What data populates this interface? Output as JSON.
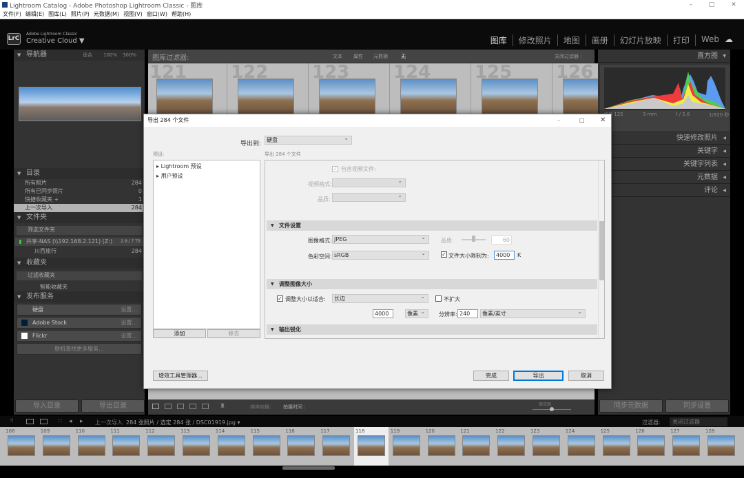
{
  "window": {
    "title": "Lightroom Catalog - Adobe Photoshop Lightroom Classic - 图库",
    "controls": [
      "–",
      "□",
      "✕"
    ]
  },
  "menu": [
    "文件(F)",
    "编辑(E)",
    "图库(L)",
    "照片(P)",
    "元数据(M)",
    "视图(V)",
    "窗口(W)",
    "帮助(H)"
  ],
  "identity": {
    "logo": "LrC",
    "line1": "Adobe Lightroom Classic",
    "line2": "Creative Cloud ▼"
  },
  "modules": [
    {
      "label": "图库",
      "active": true
    },
    {
      "label": "修改照片"
    },
    {
      "label": "地图"
    },
    {
      "label": "画册"
    },
    {
      "label": "幻灯片放映"
    },
    {
      "label": "打印"
    },
    {
      "label": "Web"
    }
  ],
  "navigator": {
    "title": "导航器",
    "zoom": [
      "适合",
      "100%",
      "300%"
    ]
  },
  "catalog": {
    "title": "目录",
    "items": [
      {
        "label": "所有照片",
        "count": "284"
      },
      {
        "label": "所有已同步照片",
        "count": "0"
      },
      {
        "label": "快捷收藏夹 +",
        "count": "1"
      },
      {
        "label": "上一次导入",
        "count": "284",
        "selected": true
      }
    ]
  },
  "folders": {
    "title": "文件夹",
    "filter": "筛选文件夹",
    "volume": "共享-NAS (\\\\192.168.2.121) (Z:)",
    "volume_size": "2.9 / 7 TB",
    "folder": "川西旅行",
    "folder_count": "284"
  },
  "collections": {
    "title": "收藏夹",
    "filter": "过滤收藏夹",
    "smart": "智能收藏夹"
  },
  "publish": {
    "title": "发布服务",
    "services": [
      {
        "label": "硬盘",
        "action": "设置..."
      },
      {
        "label": "Adobe Stock",
        "action": "设置..."
      },
      {
        "label": "Flickr",
        "action": "设置..."
      }
    ],
    "more": "联机查找更多服务..."
  },
  "left_buttons": {
    "import": "导入目录",
    "export": "导出目录"
  },
  "filter_bar": {
    "label": "图库过滤器:",
    "tabs": [
      "文本",
      "属性",
      "元数据",
      "无"
    ],
    "close": "关闭过滤器 :"
  },
  "grid": {
    "cells": [
      "121",
      "122",
      "123",
      "124",
      "125",
      "126"
    ]
  },
  "toolbar": {
    "sort_label": "排序依据:",
    "sort_value": "拍摄时间 :",
    "thumb_label": "缩览图"
  },
  "right": {
    "histogram": "直方图",
    "exif": {
      "iso": "ISO 125",
      "focal": "9 mm",
      "aperture": "f / 5.6",
      "shutter": "1/320 秒"
    },
    "panels": [
      "快速修改照片",
      "关键字",
      "关键字列表",
      "元数据",
      "评论"
    ],
    "sync_meta": "同步元数据",
    "sync_settings": "同步设置"
  },
  "filmstrip": {
    "source": "上一次导入",
    "info": "284 张照片 / 选定 284 张 / DSC01919.jpg ▾",
    "filter_label": "过滤器:",
    "filter_value": "关闭过滤器",
    "numbers": [
      "108",
      "109",
      "110",
      "111",
      "112",
      "113",
      "114",
      "115",
      "116",
      "117",
      "118",
      "119",
      "120",
      "121",
      "122",
      "123",
      "124",
      "125",
      "126",
      "127",
      "128"
    ],
    "selected": "118"
  },
  "dialog": {
    "title": "导出 284 个文件",
    "export_to_label": "导出到:",
    "export_to": "硬盘",
    "preset_label": "预设:",
    "summary": "导出 284 个文件",
    "presets": [
      "Lightroom 预设",
      "用户预设"
    ],
    "add": "添加",
    "remove": "移去",
    "video": {
      "include": "包含视频文件:",
      "format": "视频格式:",
      "quality": "品质:"
    },
    "file_settings": {
      "title": "文件设置",
      "format_label": "图像格式:",
      "format": "JPEG",
      "quality_label": "品质:",
      "quality": "60",
      "colorspace_label": "色彩空间:",
      "colorspace": "sRGB",
      "limit_label": "文件大小限制为:",
      "limit": "4000",
      "limit_unit": "K",
      "limit_checked": true
    },
    "resize": {
      "title": "调整图像大小",
      "fit_label": "调整大小以适合:",
      "fit": "长边",
      "fit_checked": true,
      "no_enlarge": "不扩大",
      "size": "4000",
      "unit": "像素",
      "res_label": "分辨率:",
      "res": "240",
      "res_unit": "像素/英寸"
    },
    "sharpen": {
      "title": "输出锐化"
    },
    "plugin_manager": "增效工具管理器...",
    "done": "完成",
    "export": "导出",
    "cancel": "取消"
  }
}
